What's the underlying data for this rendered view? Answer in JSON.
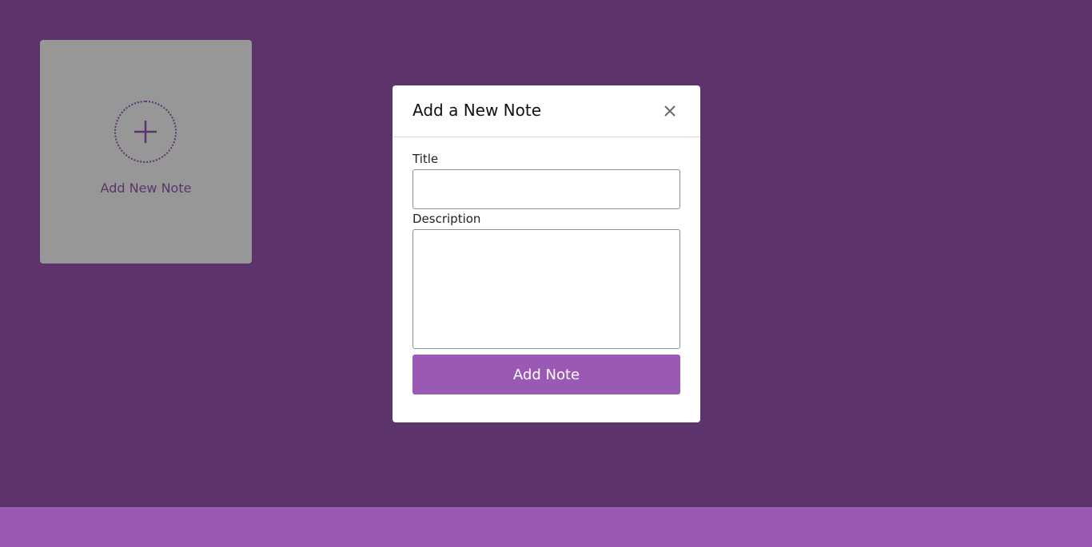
{
  "card": {
    "label": "Add New Note",
    "icon": "plus-icon"
  },
  "modal": {
    "title": "Add a New Note",
    "close_icon": "close-icon",
    "title_label": "Title",
    "title_value": "",
    "description_label": "Description",
    "description_value": "",
    "submit_label": "Add Note"
  },
  "colors": {
    "background": "#5c346b",
    "card": "#979797",
    "accent": "#9a59b5",
    "modal": "#ffffff"
  }
}
